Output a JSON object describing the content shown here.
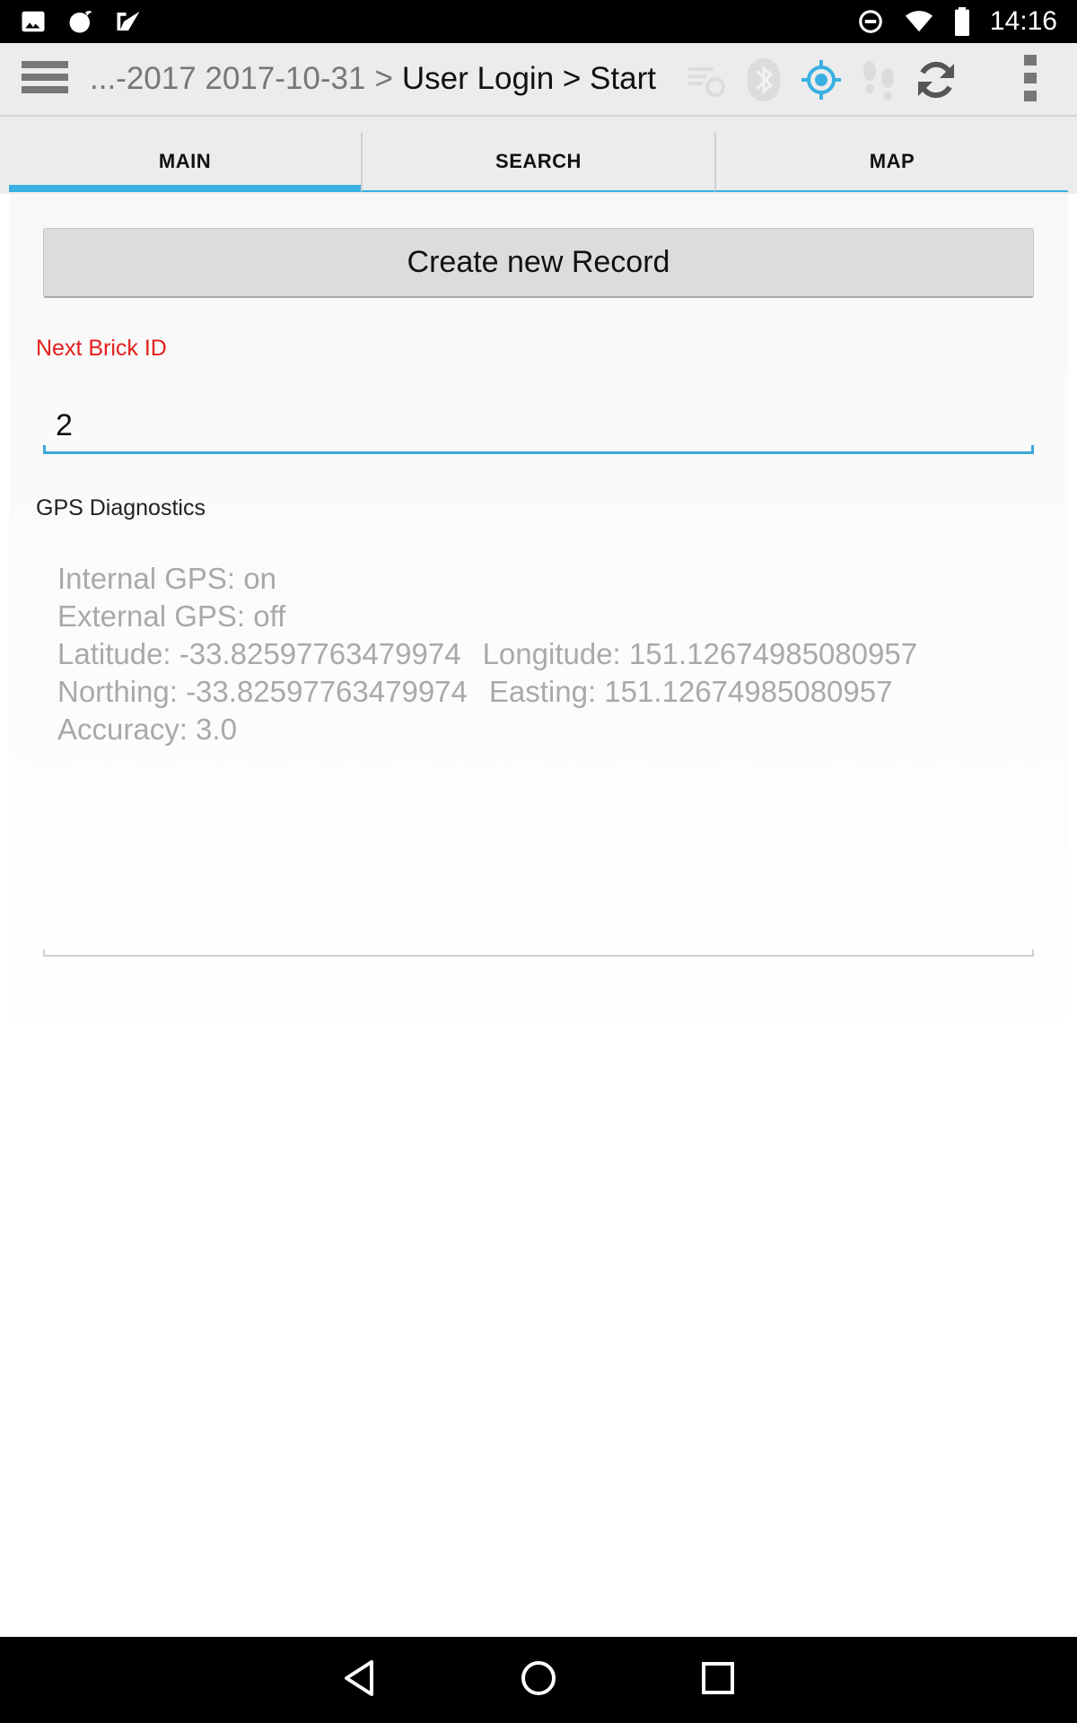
{
  "status_bar": {
    "time": "14:16",
    "left_icons": [
      "image-icon",
      "notification-app-icon",
      "check-app-icon"
    ],
    "right_icons": [
      "do-not-disturb-icon",
      "wifi-icon",
      "battery-icon"
    ]
  },
  "action_bar": {
    "breadcrumb_prefix": "...-2017 2017-10-31",
    "breadcrumb_sep": ">",
    "breadcrumb_current": "User Login > Start",
    "icons": [
      "sync-disabled-icon",
      "bluetooth-icon",
      "gps-icon",
      "footprints-icon",
      "refresh-icon"
    ],
    "accent_color": "#3ab0e2"
  },
  "tabs": [
    {
      "label": "MAIN",
      "active": true
    },
    {
      "label": "SEARCH",
      "active": false
    },
    {
      "label": "MAP",
      "active": false
    }
  ],
  "main": {
    "create_button_label": "Create new Record",
    "next_brick_label": "Next Brick ID",
    "next_brick_value": "2",
    "gps_label": "GPS Diagnostics",
    "gps": {
      "internal": "Internal GPS: on",
      "external": "External GPS: off",
      "latitude": "Latitude: -33.82597763479974",
      "longitude": "Longitude: 151.12674985080957",
      "northing": "Northing: -33.82597763479974",
      "easting": "Easting: 151.12674985080957",
      "accuracy": "Accuracy: 3.0"
    }
  },
  "nav_bar": {
    "buttons": [
      "back-icon",
      "home-icon",
      "recents-icon"
    ]
  }
}
